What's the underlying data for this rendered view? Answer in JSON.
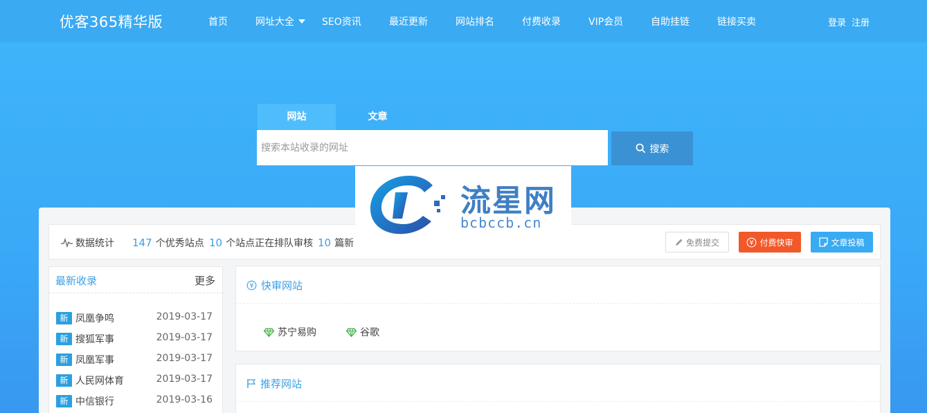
{
  "header": {
    "logo": "优客365精华版",
    "nav": [
      "首页",
      "网址大全",
      "SEO资讯",
      "最近更新",
      "网站排名",
      "付费收录",
      "VIP会员",
      "自助挂链",
      "链接买卖"
    ],
    "login": "登录",
    "register": "注册"
  },
  "search": {
    "tabs": [
      "网站",
      "文章"
    ],
    "placeholder": "搜索本站收录的网址",
    "button": "搜索"
  },
  "stats": {
    "label": "数据统计",
    "sites_count": "147",
    "sites_text": "个优秀站点",
    "pending_count": "10",
    "pending_text": "个站点正在排队审核",
    "articles_count": "10",
    "articles_text": "篇新"
  },
  "actions": {
    "free_submit": "免费提交",
    "paid_fast": "付费快审",
    "article_submit": "文章投稿"
  },
  "latest": {
    "title": "最新收录",
    "more": "更多",
    "badge": "新",
    "items": [
      {
        "name": "凤凰争鸣",
        "date": "2019-03-17"
      },
      {
        "name": "搜狐军事",
        "date": "2019-03-17"
      },
      {
        "name": "凤凰军事",
        "date": "2019-03-17"
      },
      {
        "name": "人民网体育",
        "date": "2019-03-17"
      },
      {
        "name": "中信银行",
        "date": "2019-03-16"
      }
    ]
  },
  "fast_review": {
    "title": "快审网站",
    "sites": [
      "苏宁易购",
      "谷歌"
    ]
  },
  "recommend": {
    "title": "推荐网站"
  },
  "watermark": {
    "name": "流星网",
    "domain": "bcbccb.cn"
  },
  "colors": {
    "accent": "#3aa0e8",
    "header": "#3aaaf2",
    "paid": "#f2592a"
  }
}
